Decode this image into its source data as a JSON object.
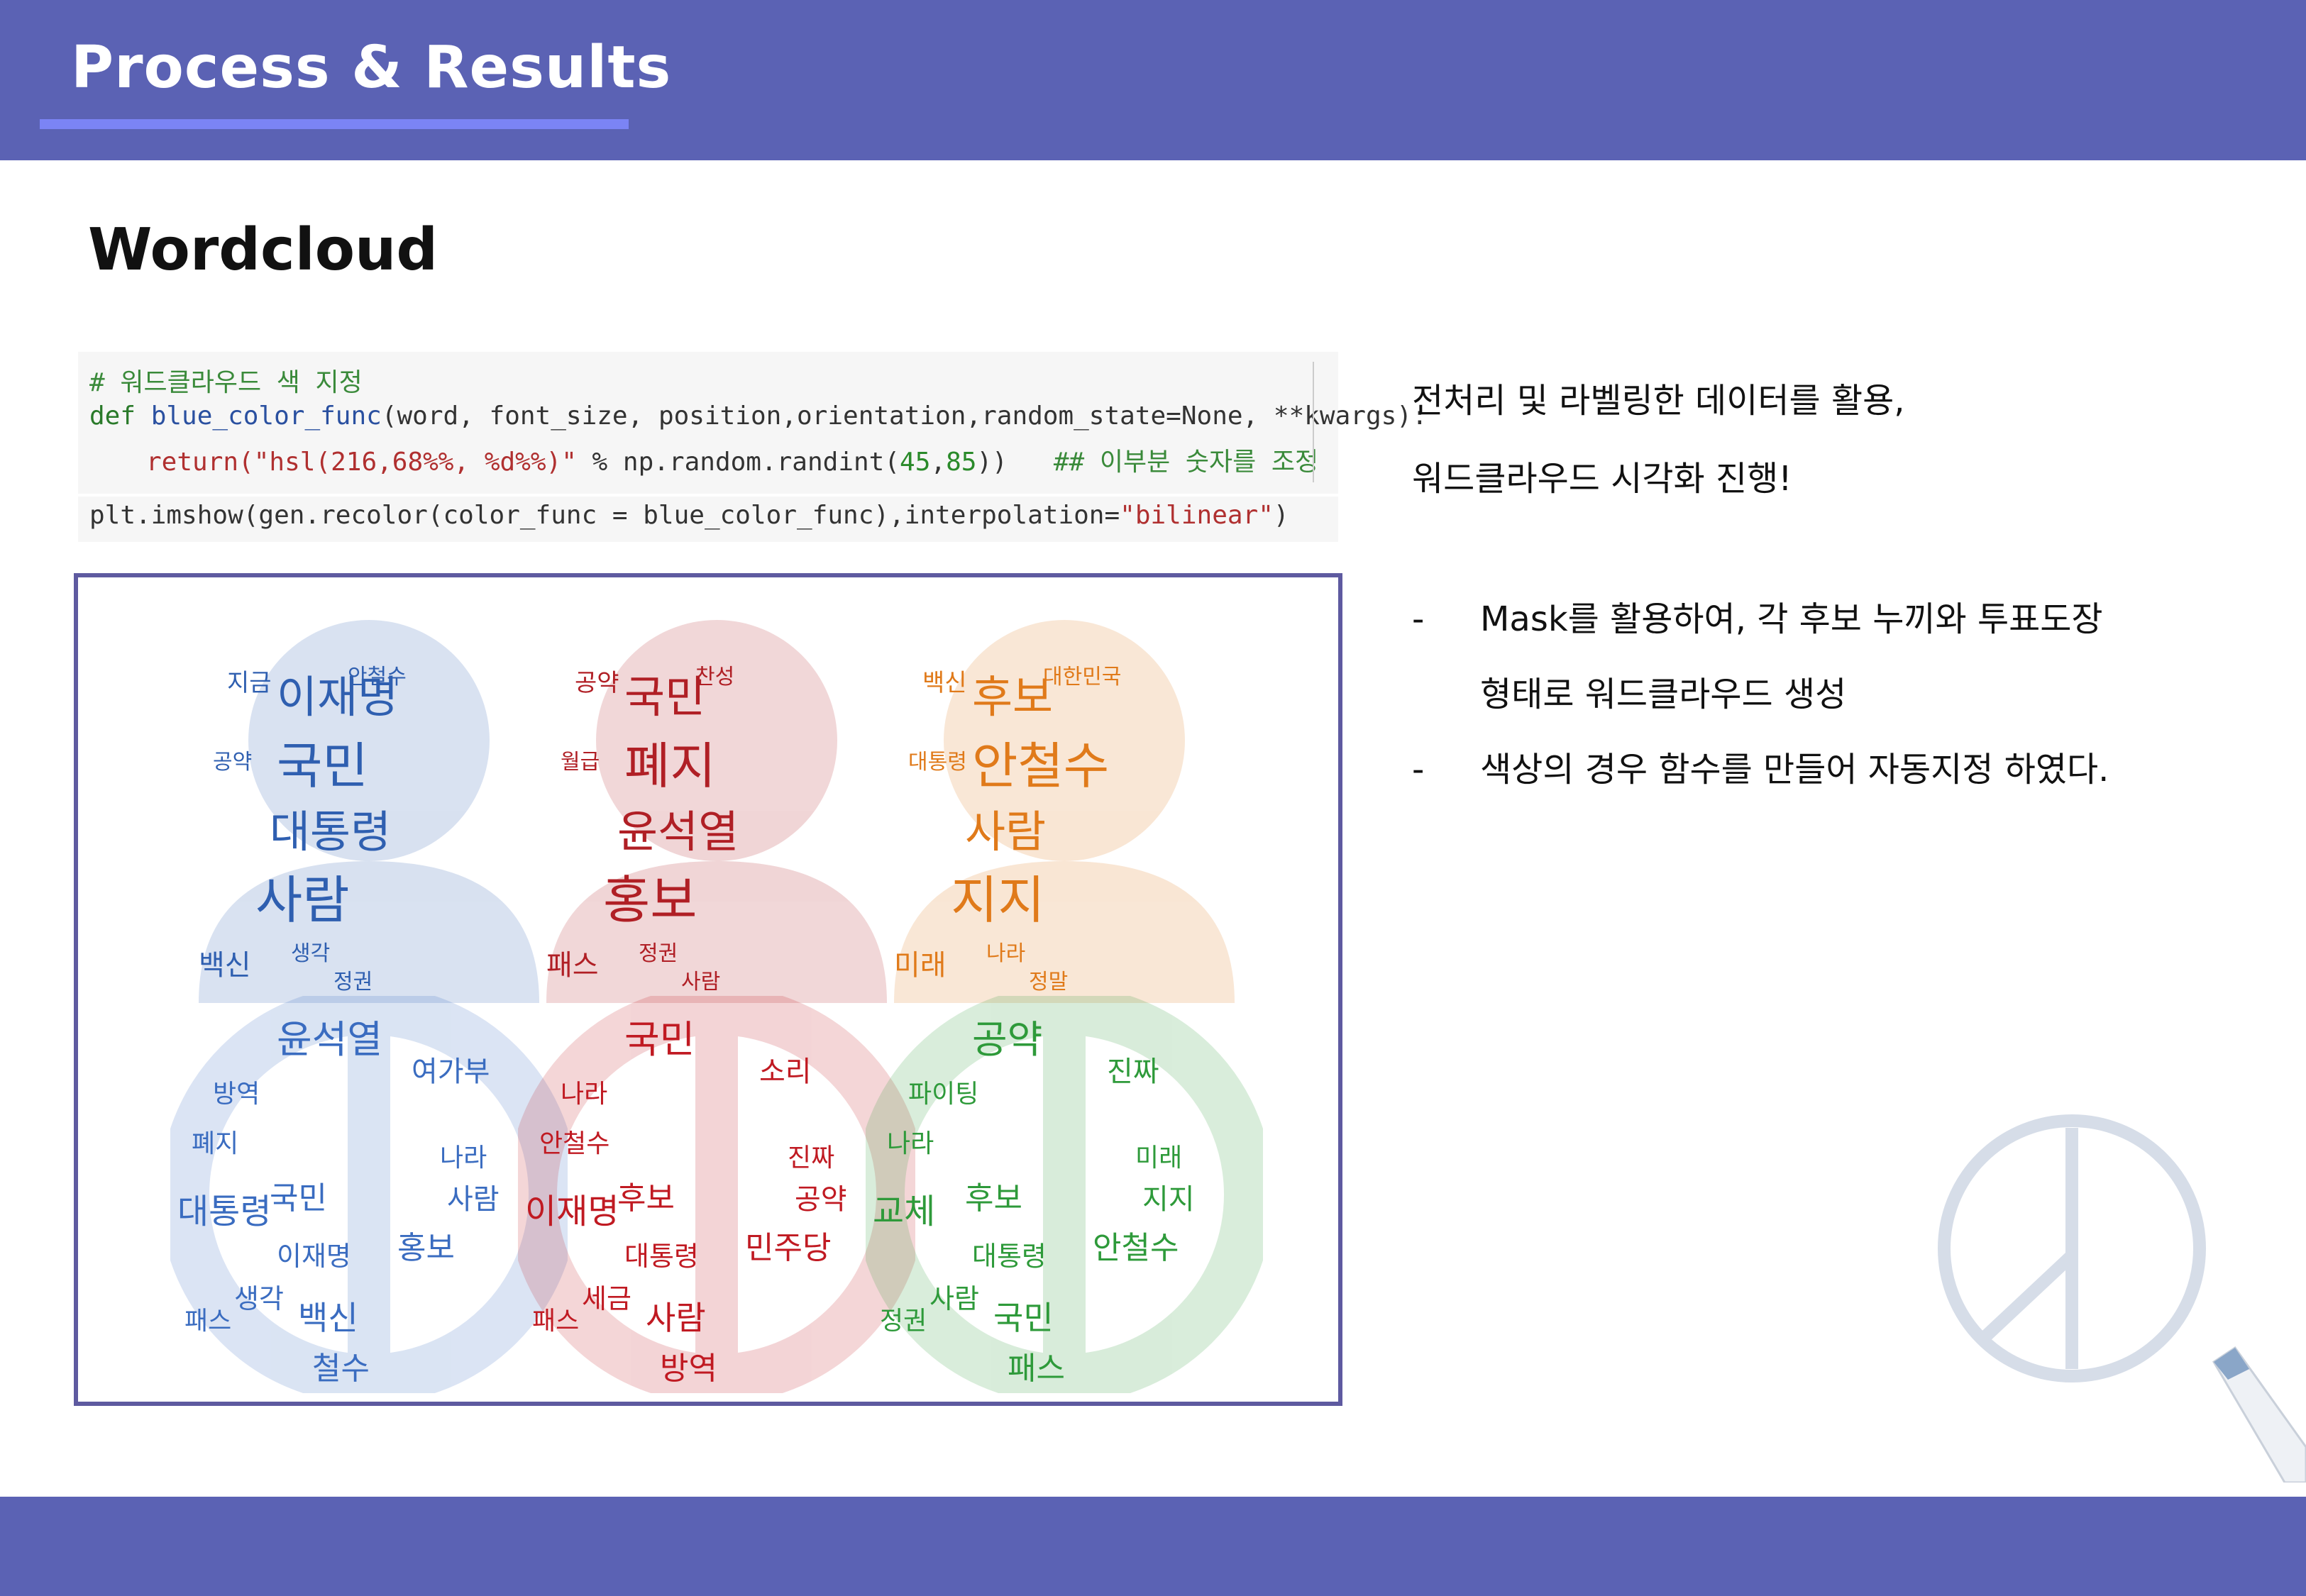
{
  "header": {
    "title": "Process & Results"
  },
  "section": {
    "title": "Wordcloud"
  },
  "code": {
    "line1": "# 워드클라우드 색 지정",
    "line2_def": "def ",
    "line2_fn": "blue_color_func",
    "line2_rest": "(word, font_size, position,orientation,random_state=None, **kwargs):",
    "line3_kw": "return",
    "line3_str": "(\"hsl(216,68%%, %d%%)\"",
    "line3_mid": " % np.random.randint(",
    "line3_n1": "45",
    "line3_comma": ",",
    "line3_n2": "85",
    "line3_close": "))   ",
    "line3_comment": "## 이부분 숫자를 조정",
    "line4_a": "plt.imshow(gen.recolor(color_func = blue_color_func),interpolation=",
    "line4_str": "\"bilinear\"",
    "line4_close": ")"
  },
  "description": {
    "line1": "전처리 및 라벨링한 데이터를 활용,",
    "line2": "워드클라우드 시각화 진행!"
  },
  "bullets": [
    {
      "dash": "-",
      "text": "Mask를 활용하여, 각 후보 누끼와 투표도장"
    },
    {
      "dash": "",
      "text": "형태로 워드클라우드 생성"
    },
    {
      "dash": "-",
      "text": "색상의 경우 함수를 만들어 자동지정 하였다."
    }
  ],
  "colors": {
    "bar": "#5b62b4",
    "underline": "#7b84f5",
    "frame": "#5e5aa0"
  },
  "wordclouds": [
    {
      "shape": "person",
      "color": "#2f5fb0",
      "words": [
        "이재명",
        "국민",
        "대통령",
        "사람",
        "백신",
        "지금",
        "공약",
        "안철수",
        "생각",
        "정권"
      ]
    },
    {
      "shape": "person",
      "color": "#b01f25",
      "words": [
        "국민",
        "폐지",
        "윤석열",
        "홍보",
        "패스",
        "공약",
        "월급",
        "찬성",
        "정권",
        "사람"
      ]
    },
    {
      "shape": "person",
      "color": "#e07a1a",
      "words": [
        "후보",
        "안철수",
        "사람",
        "지지",
        "미래",
        "백신",
        "대통령",
        "대한민국",
        "나라",
        "정말"
      ]
    },
    {
      "shape": "peace",
      "color": "#3a6cc0",
      "words": [
        "윤석열",
        "여가부",
        "방역",
        "폐지",
        "대통령",
        "국민",
        "이재명",
        "홍보",
        "사람",
        "백신",
        "패스",
        "생각",
        "철수",
        "나라"
      ]
    },
    {
      "shape": "peace",
      "color": "#c01a22",
      "words": [
        "국민",
        "소리",
        "나라",
        "안철수",
        "이재명",
        "후보",
        "대통령",
        "민주당",
        "공약",
        "사람",
        "패스",
        "세금",
        "방역",
        "진짜"
      ]
    },
    {
      "shape": "peace",
      "color": "#2e9a3a",
      "words": [
        "공약",
        "진짜",
        "파이팅",
        "나라",
        "교체",
        "후보",
        "대통령",
        "안철수",
        "지지",
        "국민",
        "정권",
        "사람",
        "패스",
        "미래"
      ]
    }
  ]
}
